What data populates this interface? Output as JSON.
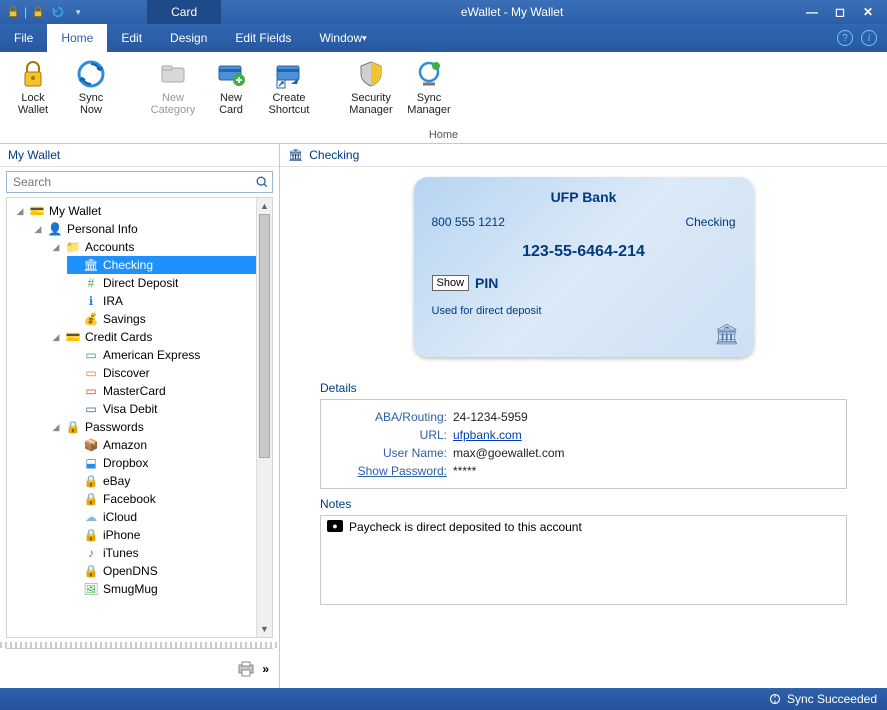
{
  "window": {
    "context_tab": "Card",
    "title": "eWallet - My Wallet"
  },
  "menu": {
    "file": "File",
    "home": "Home",
    "edit": "Edit",
    "design": "Design",
    "edit_fields": "Edit Fields",
    "window": "Window"
  },
  "ribbon": {
    "lock_wallet": "Lock\nWallet",
    "sync_now": "Sync\nNow",
    "new_category": "New\nCategory",
    "new_card": "New\nCard",
    "create_shortcut": "Create\nShortcut",
    "security_manager": "Security\nManager",
    "sync_manager": "Sync\nManager",
    "group": "Home"
  },
  "left": {
    "header": "My Wallet",
    "search_placeholder": "Search",
    "tree": {
      "root": "My Wallet",
      "personal_info": "Personal Info",
      "accounts": "Accounts",
      "checking": "Checking",
      "direct_deposit": "Direct Deposit",
      "ira": "IRA",
      "savings": "Savings",
      "credit_cards": "Credit Cards",
      "amex": "American Express",
      "discover": "Discover",
      "mastercard": "MasterCard",
      "visa_debit": "Visa Debit",
      "passwords": "Passwords",
      "amazon": "Amazon",
      "dropbox": "Dropbox",
      "ebay": "eBay",
      "facebook": "Facebook",
      "icloud": "iCloud",
      "iphone": "iPhone",
      "itunes": "iTunes",
      "opendns": "OpenDNS",
      "smugmug": "SmugMug"
    }
  },
  "right": {
    "header": "Checking",
    "card": {
      "bank": "UFP Bank",
      "phone": "800 555 1212",
      "type": "Checking",
      "number": "123-55-6464-214",
      "show_btn": "Show",
      "pin_label": "PIN",
      "usage": "Used for direct deposit"
    },
    "details_header": "Details",
    "details": {
      "routing_label": "ABA/Routing:",
      "routing_val": "24-1234-5959",
      "url_label": "URL:",
      "url_val": "ufpbank.com",
      "user_label": "User Name:",
      "user_val": "max@goewallet.com",
      "pass_label": "Show Password:",
      "pass_val": "*****"
    },
    "notes_header": "Notes",
    "notes_text": "Paycheck is direct deposited to this account"
  },
  "status": {
    "sync": "Sync Succeeded"
  }
}
